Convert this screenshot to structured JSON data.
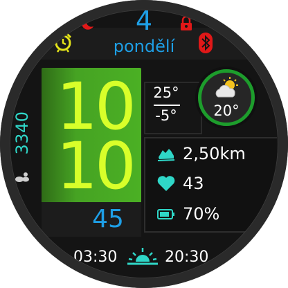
{
  "header": {
    "day_number": "4",
    "day_name": "pondělí"
  },
  "steps": {
    "count": "3340"
  },
  "time": {
    "hour": "10",
    "minute": "10",
    "seconds": "45"
  },
  "weather": {
    "temp_max": "25°",
    "temp_min": "-5°",
    "current_temp": "20°",
    "condition_icon": "partly-cloudy-icon"
  },
  "stats": {
    "distance": "2,50km",
    "heart_rate": "43",
    "battery": "70%"
  },
  "sun": {
    "sunrise": "03:30",
    "sunset": "20:30"
  },
  "colors": {
    "accent_blue": "#1e9fe6",
    "time_yellow": "#d8ff2a",
    "panel_green": "#46a323",
    "stat_teal": "#2fd7c8",
    "alert_red": "#e01818",
    "alarm_yellow": "#e4e41a"
  },
  "icons": [
    "alarm-clock-icon",
    "moon-icon",
    "lock-icon",
    "bluetooth-icon",
    "footsteps-icon",
    "running-shoe-icon",
    "heart-icon",
    "battery-icon",
    "sunrise-sunset-icon"
  ]
}
